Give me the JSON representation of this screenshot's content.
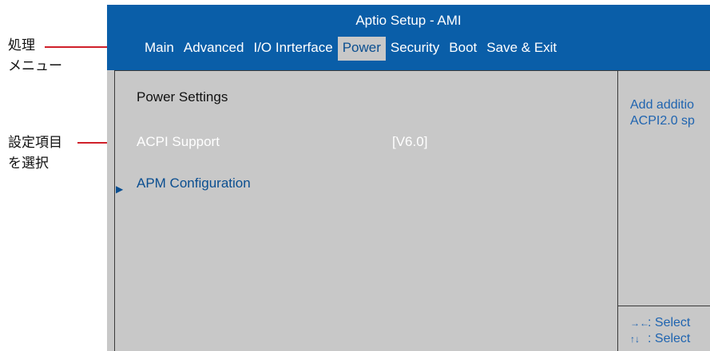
{
  "annotations": {
    "menu_label": [
      "処理",
      "メニュー"
    ],
    "item_label": [
      "設定項目",
      "を選択"
    ]
  },
  "bios": {
    "title": "Aptio Setup - AMI",
    "menu": [
      "Main",
      "Advanced",
      "I/O Inrterface",
      "Power",
      "Security",
      "Boot",
      "Save & Exit"
    ],
    "active_tab": "Power",
    "section_title": "Power  Settings",
    "rows": [
      {
        "label": "ACPI Support",
        "value": "[V6.0]",
        "selected": true
      },
      {
        "label": "APM Configuration",
        "submenu": true
      }
    ],
    "help_text": [
      "Add additio",
      "ACPI2.0 sp"
    ],
    "keys": [
      {
        "icon": "left-right-arrows-icon",
        "glyph": "→←",
        "text": ": Select"
      },
      {
        "icon": "up-down-arrows-icon",
        "glyph": "↑↓",
        "text": ": Select"
      }
    ]
  },
  "colors": {
    "header_blue": "#0a5ea8",
    "panel_gray": "#c8c8c8",
    "link_blue": "#0a4e90",
    "callout_red": "#d0202a"
  }
}
